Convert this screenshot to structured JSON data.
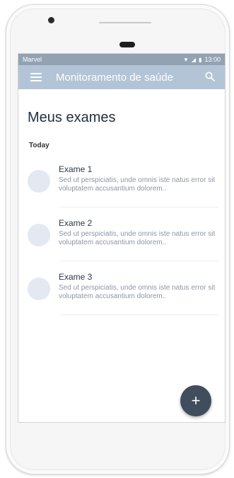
{
  "status_bar": {
    "carrier": "Marvel",
    "time": "13:00",
    "icons": [
      "wifi-icon",
      "signal-icon",
      "battery-icon"
    ]
  },
  "app_bar": {
    "title": "Monitoramento de saúde",
    "menu_icon": "menu-icon",
    "search_icon": "search-icon"
  },
  "page": {
    "title": "Meus exames",
    "section_label": "Today"
  },
  "exams": [
    {
      "title": "Exame 1",
      "description": "Sed ut perspiciatis, unde omnis iste natus error sit voluptatem accusantium dolorem.."
    },
    {
      "title": "Exame 2",
      "description": "Sed ut perspiciatis, unde omnis iste natus error sit voluptatem accusantium dolorem.."
    },
    {
      "title": "Exame 3",
      "description": "Sed ut perspiciatis, unde omnis iste natus error sit voluptatem accusantium dolorem.."
    }
  ],
  "fab": {
    "label": "+",
    "icon": "plus-icon"
  },
  "colors": {
    "status_bar": "#93a2b3",
    "app_bar": "#b3c4d6",
    "fab": "#3f4d5d",
    "avatar": "#e3e8f1"
  }
}
